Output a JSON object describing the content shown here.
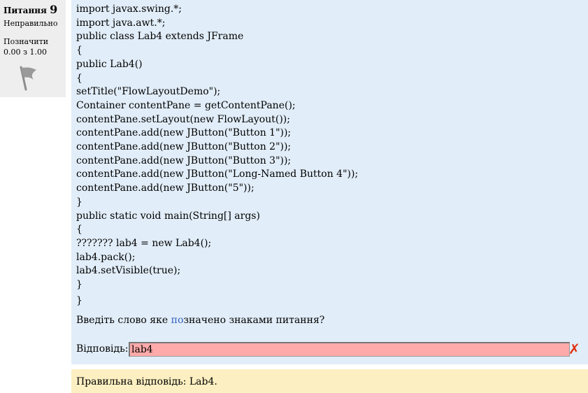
{
  "question_info": {
    "label": "Питання",
    "number": "9",
    "state": "Неправильно",
    "flag_label": "Позначити",
    "grade": "0.00 з 1.00"
  },
  "question": {
    "code_lines": [
      "import javax.swing.*;",
      "import java.awt.*;",
      "public class Lab4 extends JFrame",
      "{",
      "public Lab4()",
      "{",
      "setTitle(\"FlowLayoutDemo\");",
      "Container contentPane = getContentPane();",
      "contentPane.setLayout(new FlowLayout());",
      "contentPane.add(new JButton(\"Button 1\"));",
      "contentPane.add(new JButton(\"Button 2\"));",
      "contentPane.add(new JButton(\"Button 3\"));",
      "contentPane.add(new JButton(\"Long-Named Button 4\"));",
      "contentPane.add(new JButton(\"5\"));",
      "}",
      "public static void main(String[] args)",
      "{",
      "??????? lab4 = new Lab4();",
      "lab4.pack();",
      "lab4.setVisible(true);",
      "}"
    ],
    "closing_brace": "}",
    "prompt": {
      "before": "Введіть слово яке ",
      "highlight": "по",
      "after": "значено знаками питання?"
    },
    "highlight_color": "#3060c0"
  },
  "answer": {
    "label": "Відповідь:",
    "value": "lab4",
    "incorrect_mark": "✗",
    "incorrect_color": "#e03010"
  },
  "feedback": {
    "text": "Правильна відповідь: Lab4."
  }
}
